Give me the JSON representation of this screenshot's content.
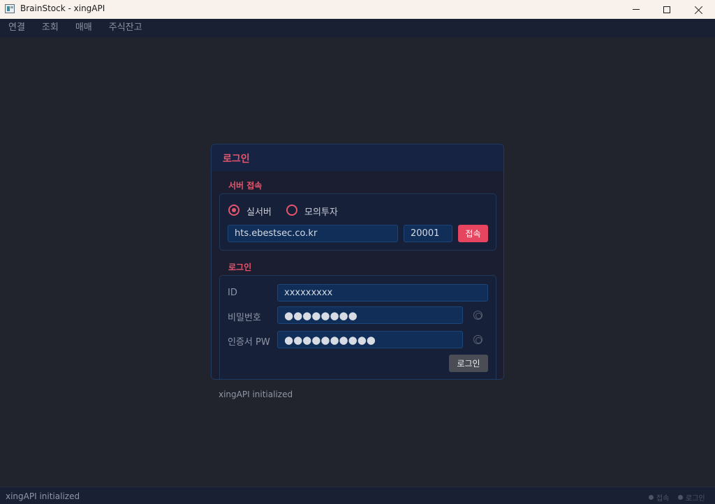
{
  "window": {
    "title": "BrainStock - xingAPI"
  },
  "menu": {
    "items": [
      "연결",
      "조회",
      "매매",
      "주식잔고"
    ]
  },
  "panel": {
    "title": "로그인",
    "server_section": {
      "label": "서버 접속",
      "radio_real": "실서버",
      "radio_mock": "모의투자",
      "selected": "실서버",
      "host_value": "hts.ebestsec.co.kr",
      "port_value": "20001",
      "connect_label": "접속"
    },
    "login_section": {
      "label": "로그인",
      "id_label": "ID",
      "id_value": "xxxxxxxxx",
      "password_label": "비밀번호",
      "password_value": "●●●●●●●●",
      "cert_label": "인증서 PW",
      "cert_value": "●●●●●●●●●●",
      "login_label": "로그인"
    }
  },
  "log": {
    "message": "xingAPI initialized"
  },
  "statusbar": {
    "message": "xingAPI initialized",
    "connect_indicator": "접속",
    "login_indicator": "로그인"
  },
  "colors": {
    "accent": "#e5556c",
    "background": "#21232d",
    "panel": "#1a1e30",
    "field": "#102e58"
  },
  "icons": {
    "window_icon": "app-icon",
    "password_toggle": "eye-icon"
  }
}
